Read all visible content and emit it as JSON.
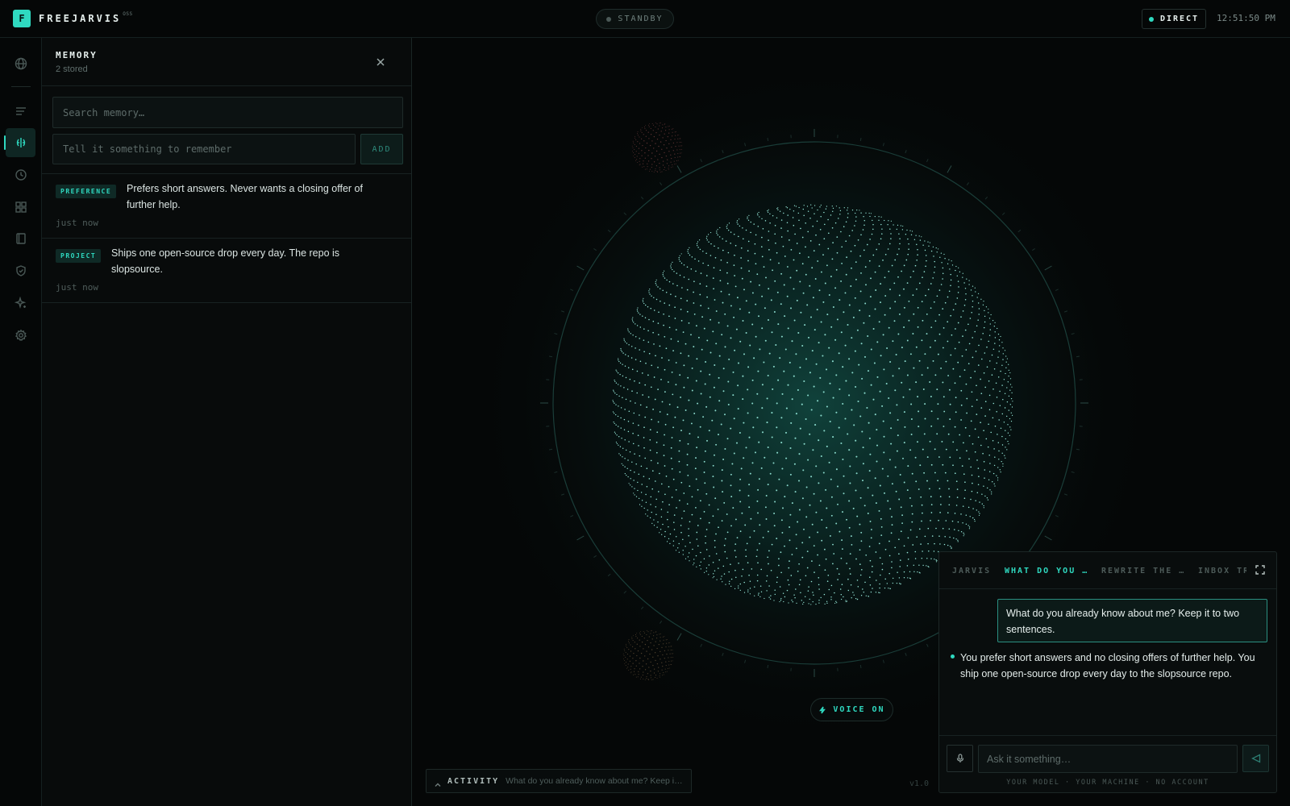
{
  "app": {
    "logo_letter": "F",
    "name": "FREEJARVIS",
    "name_superscript": "OSS",
    "status": "STANDBY",
    "mode": "DIRECT",
    "time": "12:51:50 PM",
    "version": "v1.0",
    "colors": {
      "accent": "#2fd9c0",
      "background": "#050707",
      "panel": "#080b0b"
    }
  },
  "rail": {
    "items": [
      {
        "icon": "globe-icon",
        "active": false
      },
      {
        "icon": "lines-icon",
        "active": false
      },
      {
        "icon": "memory-icon",
        "active": true
      },
      {
        "icon": "clock-icon",
        "active": false
      },
      {
        "icon": "grid-icon",
        "active": false
      },
      {
        "icon": "book-icon",
        "active": false
      },
      {
        "icon": "shield-icon",
        "active": false
      },
      {
        "icon": "sparkle-icon",
        "active": false
      },
      {
        "icon": "gear-icon",
        "active": false
      }
    ]
  },
  "memory": {
    "title": "MEMORY",
    "count_label": "2 stored",
    "search_placeholder": "Search memory…",
    "remember_placeholder": "Tell it something to remember",
    "add_label": "ADD",
    "items": [
      {
        "tag": "PREFERENCE",
        "text": "Prefers short answers. Never wants a closing offer of further help.",
        "time": "just now"
      },
      {
        "tag": "PROJECT",
        "text": "Ships one open-source drop every day. The repo is slopsource.",
        "time": "just now"
      }
    ]
  },
  "stage": {
    "voice_label": "VOICE ON",
    "activity_label": "ACTIVITY",
    "activity_text": "What do you already know about me? Keep it…"
  },
  "chat": {
    "tabs": [
      {
        "label": "JARVIS",
        "active": false
      },
      {
        "label": "WHAT DO YOU …",
        "active": true
      },
      {
        "label": "REWRITE THE …",
        "active": false
      },
      {
        "label": "INBOX TRI",
        "active": false
      }
    ],
    "user_message": "What do you already know about me? Keep it to two sentences.",
    "assistant_message": "You prefer short answers and no closing offers of further help. You ship one open-source drop every day to the slopsource repo.",
    "input_placeholder": "Ask it something…",
    "footer_note": "YOUR MODEL · YOUR MACHINE · NO ACCOUNT"
  }
}
